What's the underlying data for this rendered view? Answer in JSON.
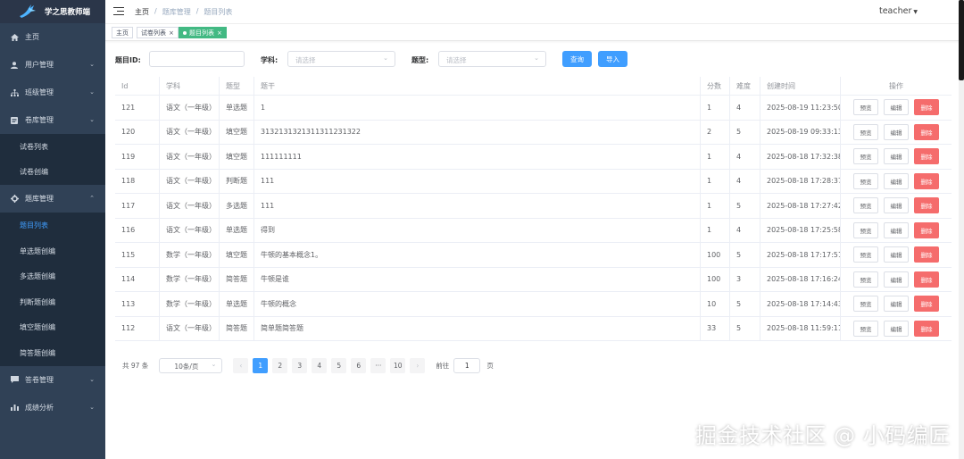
{
  "app": {
    "title": "学之思教师端"
  },
  "sidebar": {
    "items": [
      {
        "label": "主页",
        "icon": "home-icon"
      },
      {
        "label": "用户管理",
        "icon": "user-icon"
      },
      {
        "label": "班级管理",
        "icon": "org-icon"
      },
      {
        "label": "卷库管理",
        "icon": "doc-icon"
      },
      {
        "label": "题库管理",
        "icon": "gear-icon"
      },
      {
        "label": "答卷管理",
        "icon": "chat-icon"
      },
      {
        "label": "成绩分析",
        "icon": "chart-icon"
      }
    ],
    "paper_sub": [
      "试卷列表",
      "试卷创编"
    ],
    "question_sub": [
      "题目列表",
      "单选题创编",
      "多选题创编",
      "判断题创编",
      "填空题创编",
      "简答题创编"
    ]
  },
  "header": {
    "breadcrumb": [
      "主页",
      "题库管理",
      "题目列表"
    ],
    "separator": "/",
    "user": "teacher"
  },
  "tags": [
    {
      "label": "主页",
      "closable": false,
      "close": ""
    },
    {
      "label": "试卷列表",
      "closable": true,
      "close": "×"
    },
    {
      "label": "题目列表",
      "closable": true,
      "active": true,
      "close": "×"
    }
  ],
  "filters": {
    "id_label": "题目ID:",
    "subject_label": "学科:",
    "subject_placeholder": "请选择",
    "type_label": "题型:",
    "type_placeholder": "请选择",
    "search_button": "查询",
    "import_button": "导入"
  },
  "table": {
    "columns": [
      "Id",
      "学科",
      "题型",
      "题干",
      "分数",
      "难度",
      "创建时间",
      "操作"
    ],
    "rows": [
      [
        "121",
        "语文（一年级）",
        "单选题",
        "1",
        "1",
        "4",
        "2025-08-19 11:23:50"
      ],
      [
        "120",
        "语文（一年级）",
        "填空题",
        "3132131321311311231322",
        "2",
        "5",
        "2025-08-19 09:33:13"
      ],
      [
        "119",
        "语文（一年级）",
        "填空题",
        "111111111",
        "1",
        "4",
        "2025-08-18 17:32:38"
      ],
      [
        "118",
        "语文（一年级）",
        "判断题",
        "111",
        "1",
        "4",
        "2025-08-18 17:28:37"
      ],
      [
        "117",
        "语文（一年级）",
        "多选题",
        "111",
        "1",
        "5",
        "2025-08-18 17:27:42"
      ],
      [
        "116",
        "语文（一年级）",
        "单选题",
        "得到",
        "1",
        "4",
        "2025-08-18 17:25:58"
      ],
      [
        "115",
        "数学（一年级）",
        "填空题",
        "牛顿的基本概念1。",
        "100",
        "5",
        "2025-08-18 17:17:51"
      ],
      [
        "114",
        "数学（一年级）",
        "简答题",
        "牛顿是谁",
        "100",
        "3",
        "2025-08-18 17:16:24"
      ],
      [
        "113",
        "数学（一年级）",
        "单选题",
        "牛顿的概念",
        "10",
        "5",
        "2025-08-18 17:14:43"
      ],
      [
        "112",
        "语文（一年级）",
        "简答题",
        "简单题简答题",
        "33",
        "5",
        "2025-08-18 11:59:11"
      ]
    ],
    "actions": {
      "preview": "预览",
      "edit": "编辑",
      "delete": "删除"
    }
  },
  "pagination": {
    "total": "共 97 条",
    "page_size": "10条/页",
    "pages": [
      "1",
      "2",
      "3",
      "4",
      "5",
      "6",
      "···",
      "10"
    ],
    "current": "1",
    "prev": "‹",
    "next": "›",
    "goto_label": "前往",
    "goto_value": "1",
    "goto_suffix": "页"
  },
  "watermark": "掘金技术社区 @ 小码编匠",
  "colors": {
    "sidebar": "#304156",
    "primary": "#409eff",
    "danger": "#f56c6c",
    "tag_active": "#42b983"
  }
}
